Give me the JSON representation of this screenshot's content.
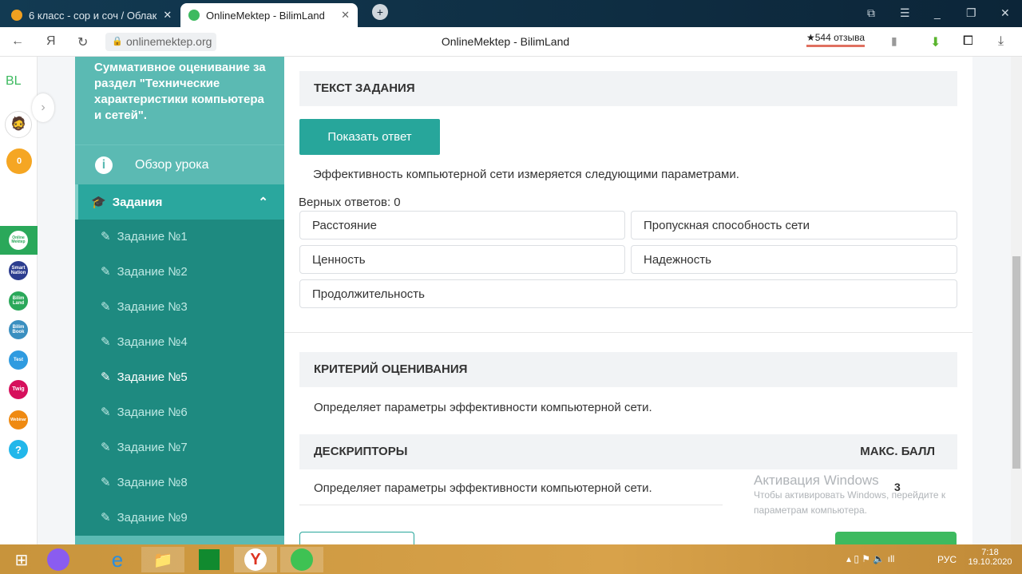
{
  "browser": {
    "tabs": [
      {
        "label": "6 класс - сор и соч / Облак"
      },
      {
        "label": "OnlineMektep - BilimLand"
      }
    ],
    "url": "onlinemektep.org",
    "page_title": "OnlineMektep - BilimLand",
    "reviews": "★544 отзыва"
  },
  "rail": {
    "logo": "BL",
    "score": "0",
    "apps": [
      "Online Mektep",
      "Smart Nation",
      "Bilim Land",
      "Bilim Book",
      "Test",
      "Twig",
      "Webinar",
      "?"
    ]
  },
  "sidebar": {
    "lesson_title": "Суммативное оценивание за раздел \"Технические характеристики компьютера и сетей\".",
    "overview": "Обзор урока",
    "tasks_header": "Задания",
    "tasks": [
      "Задание №1",
      "Задание №2",
      "Задание №3",
      "Задание №4",
      "Задание №5",
      "Задание №6",
      "Задание №7",
      "Задание №8",
      "Задание №9"
    ],
    "current_task": 5
  },
  "main": {
    "task_text_header": "ТЕКСТ ЗАДАНИЯ",
    "show_answer": "Показать ответ",
    "question": "Эффективность компьютерной сети измеряется следующими параметрами.",
    "correct_count": "Верных ответов: 0",
    "options": [
      "Расстояние",
      "Пропускная способность сети",
      "Ценность",
      "Надежность",
      "Продолжительность"
    ],
    "criteria_header": "КРИТЕРИЙ ОЦЕНИВАНИЯ",
    "criteria": "Определяет параметры эффективности компьютерной сети.",
    "descriptors_header": "ДЕСКРИПТОРЫ",
    "max_score_header": "МАКС. БАЛЛ",
    "descriptor": "Определяет параметры эффективности компьютерной сети.",
    "max_score": "3"
  },
  "watermark": {
    "title": "Активация Windows",
    "text": "Чтобы активировать Windows, перейдите к параметрам компьютера."
  },
  "taskbar": {
    "lang": "РУС",
    "time": "7:18",
    "date": "19.10.2020"
  },
  "colors": {
    "teal": "#27a69b",
    "accent_green": "#3dba5f",
    "taskbar": "#c8943c"
  }
}
